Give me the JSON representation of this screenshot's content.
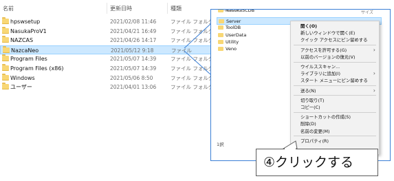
{
  "header": {
    "col_name": "名前",
    "col_date": "更新日時",
    "col_type": "種類",
    "col_size": "サイズ"
  },
  "files": [
    {
      "name": "hpswsetup",
      "date": "2021/02/08 11:46",
      "type": "ファイル フォルダー",
      "selected": false
    },
    {
      "name": "NasukaProV1",
      "date": "2021/04/21 16:49",
      "type": "ファイル フォルダー",
      "selected": false
    },
    {
      "name": "NAZCAS",
      "date": "2021/04/26 14:17",
      "type": "ファイル フォルダー",
      "selected": false
    },
    {
      "name": "NazcaNeo",
      "date": "2021/05/12 9:18",
      "type": "ファイル",
      "selected": true
    },
    {
      "name": "Program Files",
      "date": "2021/05/07 14:39",
      "type": "ファイル フォルダー",
      "selected": false
    },
    {
      "name": "Program Files (x86)",
      "date": "2021/05/07 14:39",
      "type": "ファイル フォルダー",
      "selected": false
    },
    {
      "name": "Windows",
      "date": "2021/05/06 8:50",
      "type": "ファイル フォルダー",
      "selected": false
    },
    {
      "name": "ユーザー",
      "date": "2021/04/01 13:06",
      "type": "ファイル フォルダー",
      "selected": false
    }
  ],
  "popup": {
    "header_size": "サイズ",
    "folders": [
      {
        "name": "NasukaSCDB",
        "selected": false
      },
      {
        "name": "Server",
        "selected": true
      },
      {
        "name": "ToolDB",
        "selected": false
      },
      {
        "name": "UserData",
        "selected": false
      },
      {
        "name": "Utility",
        "selected": false
      },
      {
        "name": "Veno",
        "selected": false
      }
    ],
    "item_count": "1択"
  },
  "context_menu": [
    {
      "label": "開く(O)",
      "bold": true,
      "arrow": false
    },
    {
      "label": "新しいウィンドウで開く(E)",
      "bold": false,
      "arrow": false
    },
    {
      "label": "クイック アクセスにピン留めする",
      "bold": false,
      "arrow": false
    },
    {
      "separator": true
    },
    {
      "label": "アクセスを許可する(G)",
      "bold": false,
      "arrow": true
    },
    {
      "label": "以前のバージョンの復元(V)",
      "bold": false,
      "arrow": false
    },
    {
      "separator": true
    },
    {
      "label": "ウイルススキャン...",
      "bold": false,
      "arrow": false
    },
    {
      "label": "ライブラリに追加(I)",
      "bold": false,
      "arrow": true
    },
    {
      "label": "スタート メニューにピン留めする",
      "bold": false,
      "arrow": false
    },
    {
      "separator": true
    },
    {
      "label": "送る(N)",
      "bold": false,
      "arrow": true
    },
    {
      "separator": true
    },
    {
      "label": "切り取り(T)",
      "bold": false,
      "arrow": false
    },
    {
      "label": "コピー(C)",
      "bold": false,
      "arrow": false
    },
    {
      "separator": true
    },
    {
      "label": "ショートカットの作成(S)",
      "bold": false,
      "arrow": false
    },
    {
      "label": "削除(D)",
      "bold": false,
      "arrow": false
    },
    {
      "label": "名前の変更(M)",
      "bold": false,
      "arrow": false
    },
    {
      "separator": true
    },
    {
      "label": "プロパティ(R)",
      "bold": false,
      "arrow": false
    }
  ],
  "callout": {
    "text": "④クリックする"
  },
  "colors": {
    "selection": "#cce8ff",
    "selection_border": "#99d1ff",
    "folder": "#f8d775",
    "popup_border": "#3a7fd5"
  }
}
